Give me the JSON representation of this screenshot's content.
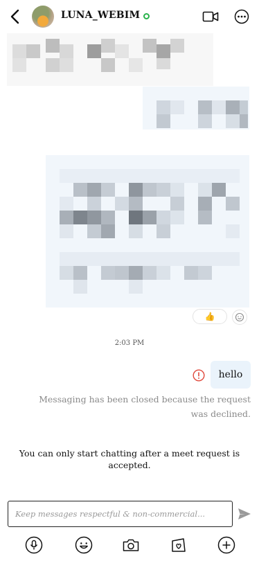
{
  "header": {
    "username": "LUNA_WEBIM",
    "online": true
  },
  "reaction": {
    "emoji": "👍"
  },
  "messages": {
    "timestamp": "2:03 PM",
    "sent_text": "hello",
    "closed_notice": "Messaging has been closed because the request was declined.",
    "info_notice": "You can only start chatting after a meet request is accepted."
  },
  "composer": {
    "placeholder": "Keep messages respectful & non-commercial..."
  },
  "toolbar": {
    "items": [
      "microphone-icon",
      "emoji-icon",
      "camera-icon",
      "gift-bag-icon",
      "add-icon"
    ]
  },
  "colors": {
    "online": "#27b24a",
    "error": "#e0483b",
    "bubble": "#eaf3fb",
    "muted_text": "#8a8a8a"
  }
}
